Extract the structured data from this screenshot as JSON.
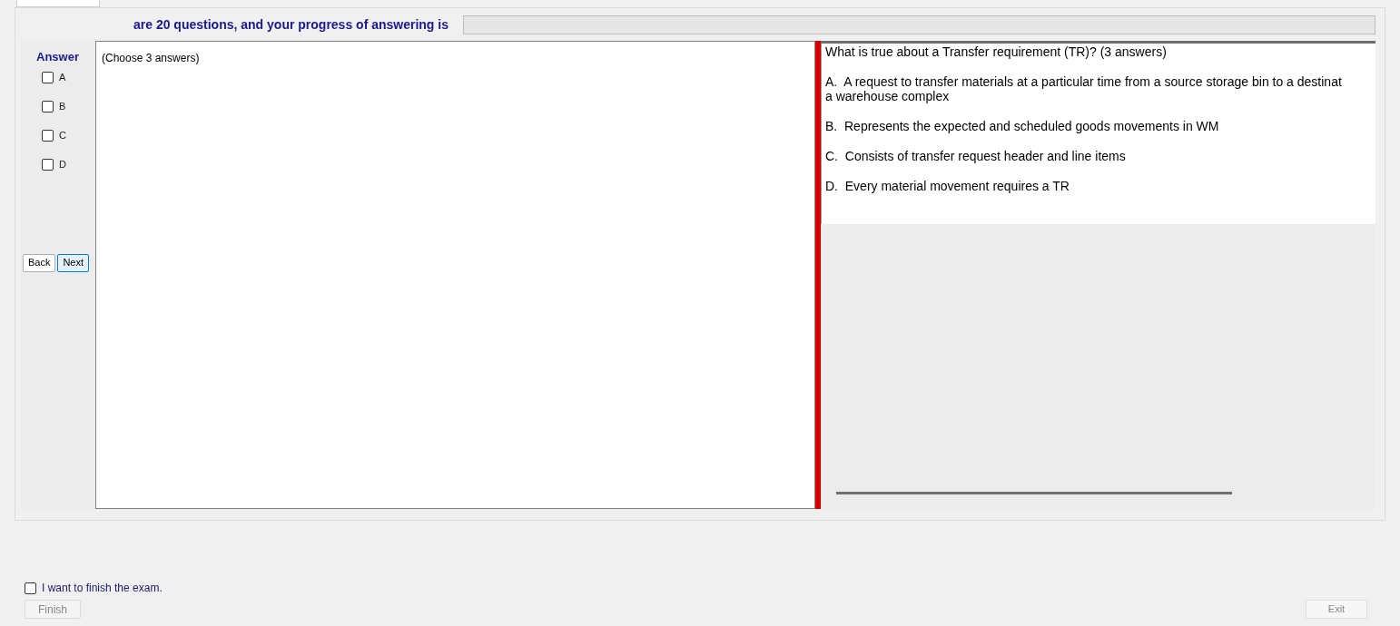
{
  "header": {
    "text": "are 20 questions, and your progress of answering is",
    "progress": {
      "level": 0
    }
  },
  "answer_panel": {
    "title": "Answer",
    "options": [
      {
        "label": "A",
        "checked": false
      },
      {
        "label": "B",
        "checked": false
      },
      {
        "label": "C",
        "checked": false
      },
      {
        "label": "D",
        "checked": false
      }
    ]
  },
  "nav_buttons": [
    {
      "label": "Back",
      "selected": false
    },
    {
      "label": "Next",
      "selected": true
    }
  ],
  "left_text": "(Choose 3 answers)",
  "question": {
    "title": "What is true about a Transfer requirement (TR)? (3 answers)",
    "choices": [
      {
        "lines": [
          "A.  A request to transfer materials at a particular time from a source storage bin to a destinat",
          "a warehouse complex"
        ]
      },
      {
        "lines": [
          "B.  Represents the expected and scheduled goods movements in WM"
        ]
      },
      {
        "lines": [
          "C.  Consists of transfer request header and line items"
        ]
      },
      {
        "lines": [
          "D.  Every material movement requires a TR"
        ]
      }
    ]
  },
  "footer": {
    "finish_check": {
      "label": "I want to finish the exam.",
      "checked": false
    },
    "finish_button": "Finish",
    "exit_button": "Exit"
  }
}
